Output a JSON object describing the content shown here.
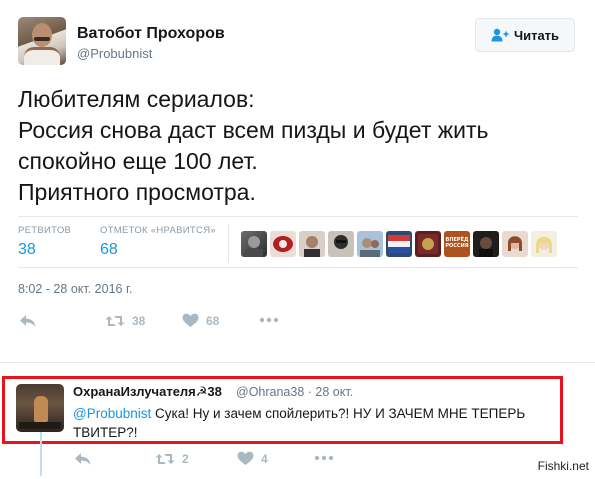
{
  "tweet": {
    "author_name": "Ватобот Прохоров",
    "author_handle": "@Probubnist",
    "follow_label": "Читать",
    "text": "Любителям сериалов:\nРоссия снова даст всем пизды и будет жить спокойно еще 100 лет.\nПриятного просмотра.",
    "stats": {
      "retweets_label": "РЕТВИТОВ",
      "retweets_value": "38",
      "likes_label": "ОТМЕТОК «НРАВИТСЯ»",
      "likes_value": "68"
    },
    "timestamp": "8:02 - 28 окт. 2016 г.",
    "actions": {
      "retweet_count": "38",
      "like_count": "68"
    },
    "likers": [
      {
        "icon": "liker-avatar-1",
        "color": "#5a5a5a"
      },
      {
        "icon": "liker-avatar-2",
        "color": "#a01e1e"
      },
      {
        "icon": "liker-avatar-3",
        "color": "#7b6a5d"
      },
      {
        "icon": "liker-avatar-4",
        "color": "#3b3b3b"
      },
      {
        "icon": "liker-avatar-5",
        "color": "#8d7b68"
      },
      {
        "icon": "liker-avatar-6",
        "color": "#3d5a7a"
      },
      {
        "icon": "liker-avatar-7",
        "color": "#6a2a2a"
      },
      {
        "icon": "liker-avatar-8",
        "color": "#b35a2a"
      },
      {
        "icon": "liker-avatar-9",
        "color": "#2a2a2a"
      },
      {
        "icon": "liker-avatar-10",
        "color": "#c98a6a"
      },
      {
        "icon": "liker-avatar-11",
        "color": "#e8d6a0"
      }
    ],
    "liker_badge_text": "ВПЕРЁД РОССИЯ"
  },
  "reply": {
    "author_name": "ОхранаИзлучателя☭38",
    "author_handle": "@Ohrana38",
    "date": "28 окт.",
    "mention": "@Probubnist",
    "text": " Сука! Ну и зачем спойлерить?!  НУ И ЗАЧЕМ МНЕ ТЕПЕРЬ ТВИТЕР?!",
    "actions": {
      "retweet_count": "2",
      "like_count": "4"
    }
  },
  "watermark": "Fishki.net",
  "colors": {
    "accent": "#1b95e0",
    "highlight_border": "#e8141b",
    "muted": "#aab8c2"
  }
}
